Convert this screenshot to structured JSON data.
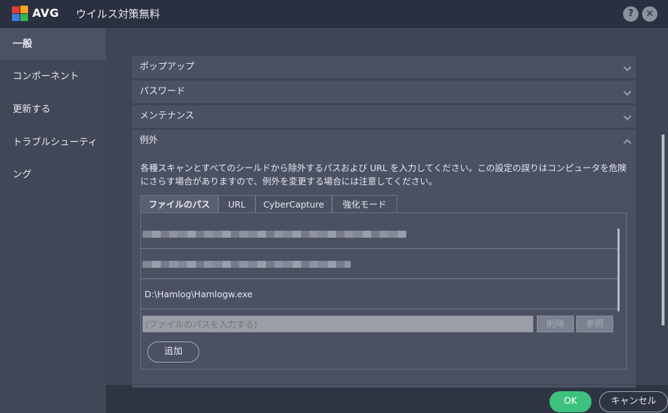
{
  "window": {
    "brand": "AVG",
    "title": "ウイルス対策無料",
    "help_label": "?",
    "close_label": "✕"
  },
  "sidebar": {
    "items": [
      {
        "label": "一般",
        "active": true
      },
      {
        "label": "コンポーネント",
        "active": false
      },
      {
        "label": "更新する",
        "active": false
      },
      {
        "label": "トラブルシューティング",
        "active": false
      }
    ]
  },
  "sections": [
    {
      "label": "ポップアップ",
      "expanded": false
    },
    {
      "label": "パスワード",
      "expanded": false
    },
    {
      "label": "メンテナンス",
      "expanded": false
    }
  ],
  "exceptions": {
    "label": "例外",
    "description": "各種スキャンとすべてのシールドから除外するパスおよび URL を入力してください。この設定の誤りはコンピュータを危険にさらす場合がありますので、例外を変更する場合には注意してください。",
    "tabs": [
      {
        "label": "ファイルのパス",
        "active": true
      },
      {
        "label": "URL",
        "active": false
      },
      {
        "label": "CyberCapture",
        "active": false
      },
      {
        "label": "強化モード",
        "active": false
      }
    ],
    "paths": [
      {
        "value": "",
        "redacted": true
      },
      {
        "value": "",
        "redacted": true
      },
      {
        "value": "D:\\Hamlog\\Hamlogw.exe",
        "redacted": false
      }
    ],
    "input": {
      "placeholder": "(ファイルのパスを入力する)",
      "value": ""
    },
    "delete_label": "削除",
    "browse_label": "参照",
    "add_label": "追加"
  },
  "footer": {
    "ok_label": "OK",
    "cancel_label": "キャンセル"
  },
  "colors": {
    "accent_green": "#3cc27e",
    "background": "#3f4555",
    "sidebar": "#414756",
    "panel": "#4b5163"
  }
}
